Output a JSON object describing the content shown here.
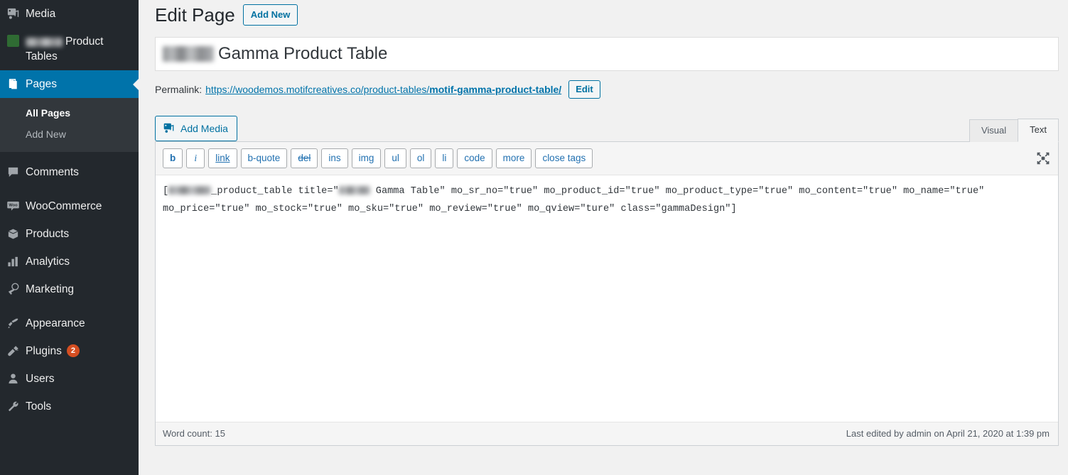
{
  "sidebar": {
    "items": [
      {
        "label": "Media",
        "icon": "media-icon",
        "active": false
      },
      {
        "label": "Product Tables",
        "icon": "green-square-icon",
        "active": false,
        "redacted_prefix": true
      },
      {
        "label": "Pages",
        "icon": "pages-icon",
        "active": true
      },
      {
        "label": "Comments",
        "icon": "comments-icon",
        "active": false
      },
      {
        "label": "WooCommerce",
        "icon": "woocommerce-icon",
        "active": false
      },
      {
        "label": "Products",
        "icon": "products-box-icon",
        "active": false
      },
      {
        "label": "Analytics",
        "icon": "analytics-bars-icon",
        "active": false
      },
      {
        "label": "Marketing",
        "icon": "marketing-megaphone-icon",
        "active": false
      },
      {
        "label": "Appearance",
        "icon": "appearance-brush-icon",
        "active": false
      },
      {
        "label": "Plugins",
        "icon": "plugins-plug-icon",
        "active": false,
        "badge": "2"
      },
      {
        "label": "Users",
        "icon": "users-icon",
        "active": false
      },
      {
        "label": "Tools",
        "icon": "tools-wrench-icon",
        "active": false
      }
    ],
    "submenu": [
      {
        "label": "All Pages",
        "current": true
      },
      {
        "label": "Add New",
        "current": false
      }
    ]
  },
  "header": {
    "page_title": "Edit Page",
    "add_new_label": "Add New"
  },
  "title_field": {
    "value": "Gamma Product Table",
    "has_redacted_prefix": true
  },
  "permalink": {
    "label": "Permalink:",
    "base": "https://woodemos.motifcreatives.co/product-tables/",
    "slug": "motif-gamma-product-table/",
    "edit_label": "Edit"
  },
  "editor": {
    "add_media_label": "Add Media",
    "tabs": [
      {
        "label": "Visual",
        "active": false
      },
      {
        "label": "Text",
        "active": true
      }
    ],
    "expand_icon": "fullscreen-expand-icon",
    "quicktags": [
      {
        "label": "b",
        "style": "bold"
      },
      {
        "label": "i",
        "style": "ital"
      },
      {
        "label": "link",
        "style": "ul-deco"
      },
      {
        "label": "b-quote",
        "style": ""
      },
      {
        "label": "del",
        "style": "strike"
      },
      {
        "label": "ins",
        "style": ""
      },
      {
        "label": "img",
        "style": ""
      },
      {
        "label": "ul",
        "style": ""
      },
      {
        "label": "ol",
        "style": ""
      },
      {
        "label": "li",
        "style": ""
      },
      {
        "label": "code",
        "style": ""
      },
      {
        "label": "more",
        "style": ""
      },
      {
        "label": "close tags",
        "style": ""
      }
    ],
    "content": {
      "open_bracket": "[",
      "shortcode_tail": "_product_table title=\"",
      "title_tail": " Gamma Table\" mo_sr_no=\"true\" mo_product_id=\"true\" mo_product_type=\"true\" mo_content=\"true\" mo_name=\"true\" mo_price=\"true\" mo_stock=\"true\" mo_sku=\"true\" mo_review=\"true\" mo_qview=\"ture\" class=\"gammaDesign\"]"
    }
  },
  "status": {
    "word_count": "Word count: 15",
    "last_edited": "Last edited by admin on April 21, 2020 at 1:39 pm"
  },
  "colors": {
    "sidebar_bg": "#23282d",
    "submenu_bg": "#32373c",
    "accent_blue": "#0073aa",
    "link_blue": "#0071a1",
    "badge_orange": "#d54e21",
    "page_bg": "#f1f1f1",
    "green_icon": "#2f6b33"
  }
}
